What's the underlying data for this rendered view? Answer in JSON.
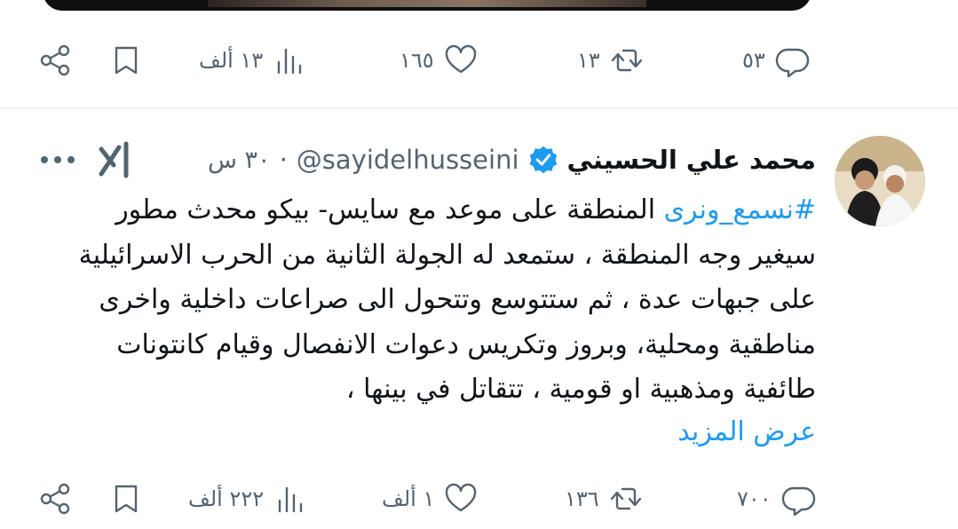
{
  "colors": {
    "text": "#0f1419",
    "muted": "#536471",
    "link": "#1d9bf0",
    "verified": "#1d9bf0"
  },
  "tweet1": {
    "actions": {
      "reply_count": "٥٣",
      "retweet_count": "١٣",
      "like_count": "١٦٥",
      "views_count": "١٣ ألف"
    }
  },
  "tweet2": {
    "author_name": "محمد علي الحسيني",
    "handle": "@sayidelhusseini",
    "separator": "·",
    "time": "٣٠ س",
    "hashtag": "#نسمع_ونرى",
    "text": " المنطقة على موعد مع سايس- بيكو محدث مطور سيغير وجه المنطقة ، ستمعد له الجولة الثانية من الحرب الاسرائيلية على جبهات عدة ، ثم ستتوسع وتتحول الى صراعات داخلية واخرى مناطقية ومحلية، وبروز وتكريس دعوات الانفصال وقيام كانتونات طائفية ومذهبية او قومية ، تتقاتل في بينها ،",
    "show_more": "عرض المزيد",
    "actions": {
      "reply_count": "٧٠٠",
      "retweet_count": "١٣٦",
      "like_count": "١ ألف",
      "views_count": "٢٢٢ ألف"
    }
  },
  "icons": [
    "reply-icon",
    "retweet-icon",
    "like-icon",
    "views-icon",
    "bookmark-icon",
    "share-icon",
    "verified-badge-icon",
    "grok-icon",
    "more-icon"
  ]
}
